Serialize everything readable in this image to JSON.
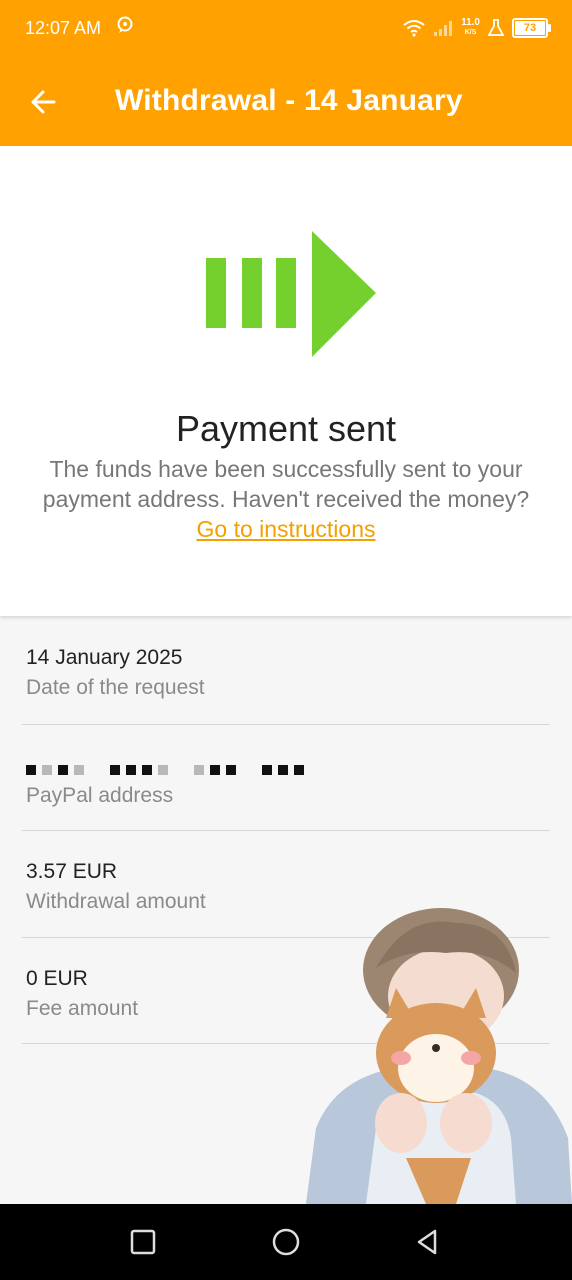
{
  "status_bar": {
    "time": "12:07 AM",
    "net_speed_top": "11.0",
    "net_speed_bottom": "K/S",
    "battery": "73",
    "icons": [
      "chat-bubble-icon",
      "wifi-icon",
      "signal-icon",
      "lab-flask-icon",
      "battery-icon"
    ]
  },
  "header": {
    "title": "Withdrawal - 14 January",
    "back_icon": "back-arrow-icon"
  },
  "payment": {
    "status_icon": "payment-sent-arrow-icon",
    "title": "Payment sent",
    "description": "The funds have been successfully sent to your payment address. Haven't received the money?",
    "link_text": "Go to instructions"
  },
  "details": [
    {
      "value": "14 January 2025",
      "label": "Date of the request"
    },
    {
      "value": "",
      "label": "PayPal address",
      "redacted": true
    },
    {
      "value": "3.57 EUR",
      "label": "Withdrawal amount"
    },
    {
      "value": "0 EUR",
      "label": "Fee amount"
    }
  ],
  "colors": {
    "accent": "#ffa100",
    "success_green": "#74d12d",
    "link": "#f3a000"
  },
  "nav": {
    "icons": [
      "recent-apps-icon",
      "home-icon",
      "back-icon"
    ]
  }
}
